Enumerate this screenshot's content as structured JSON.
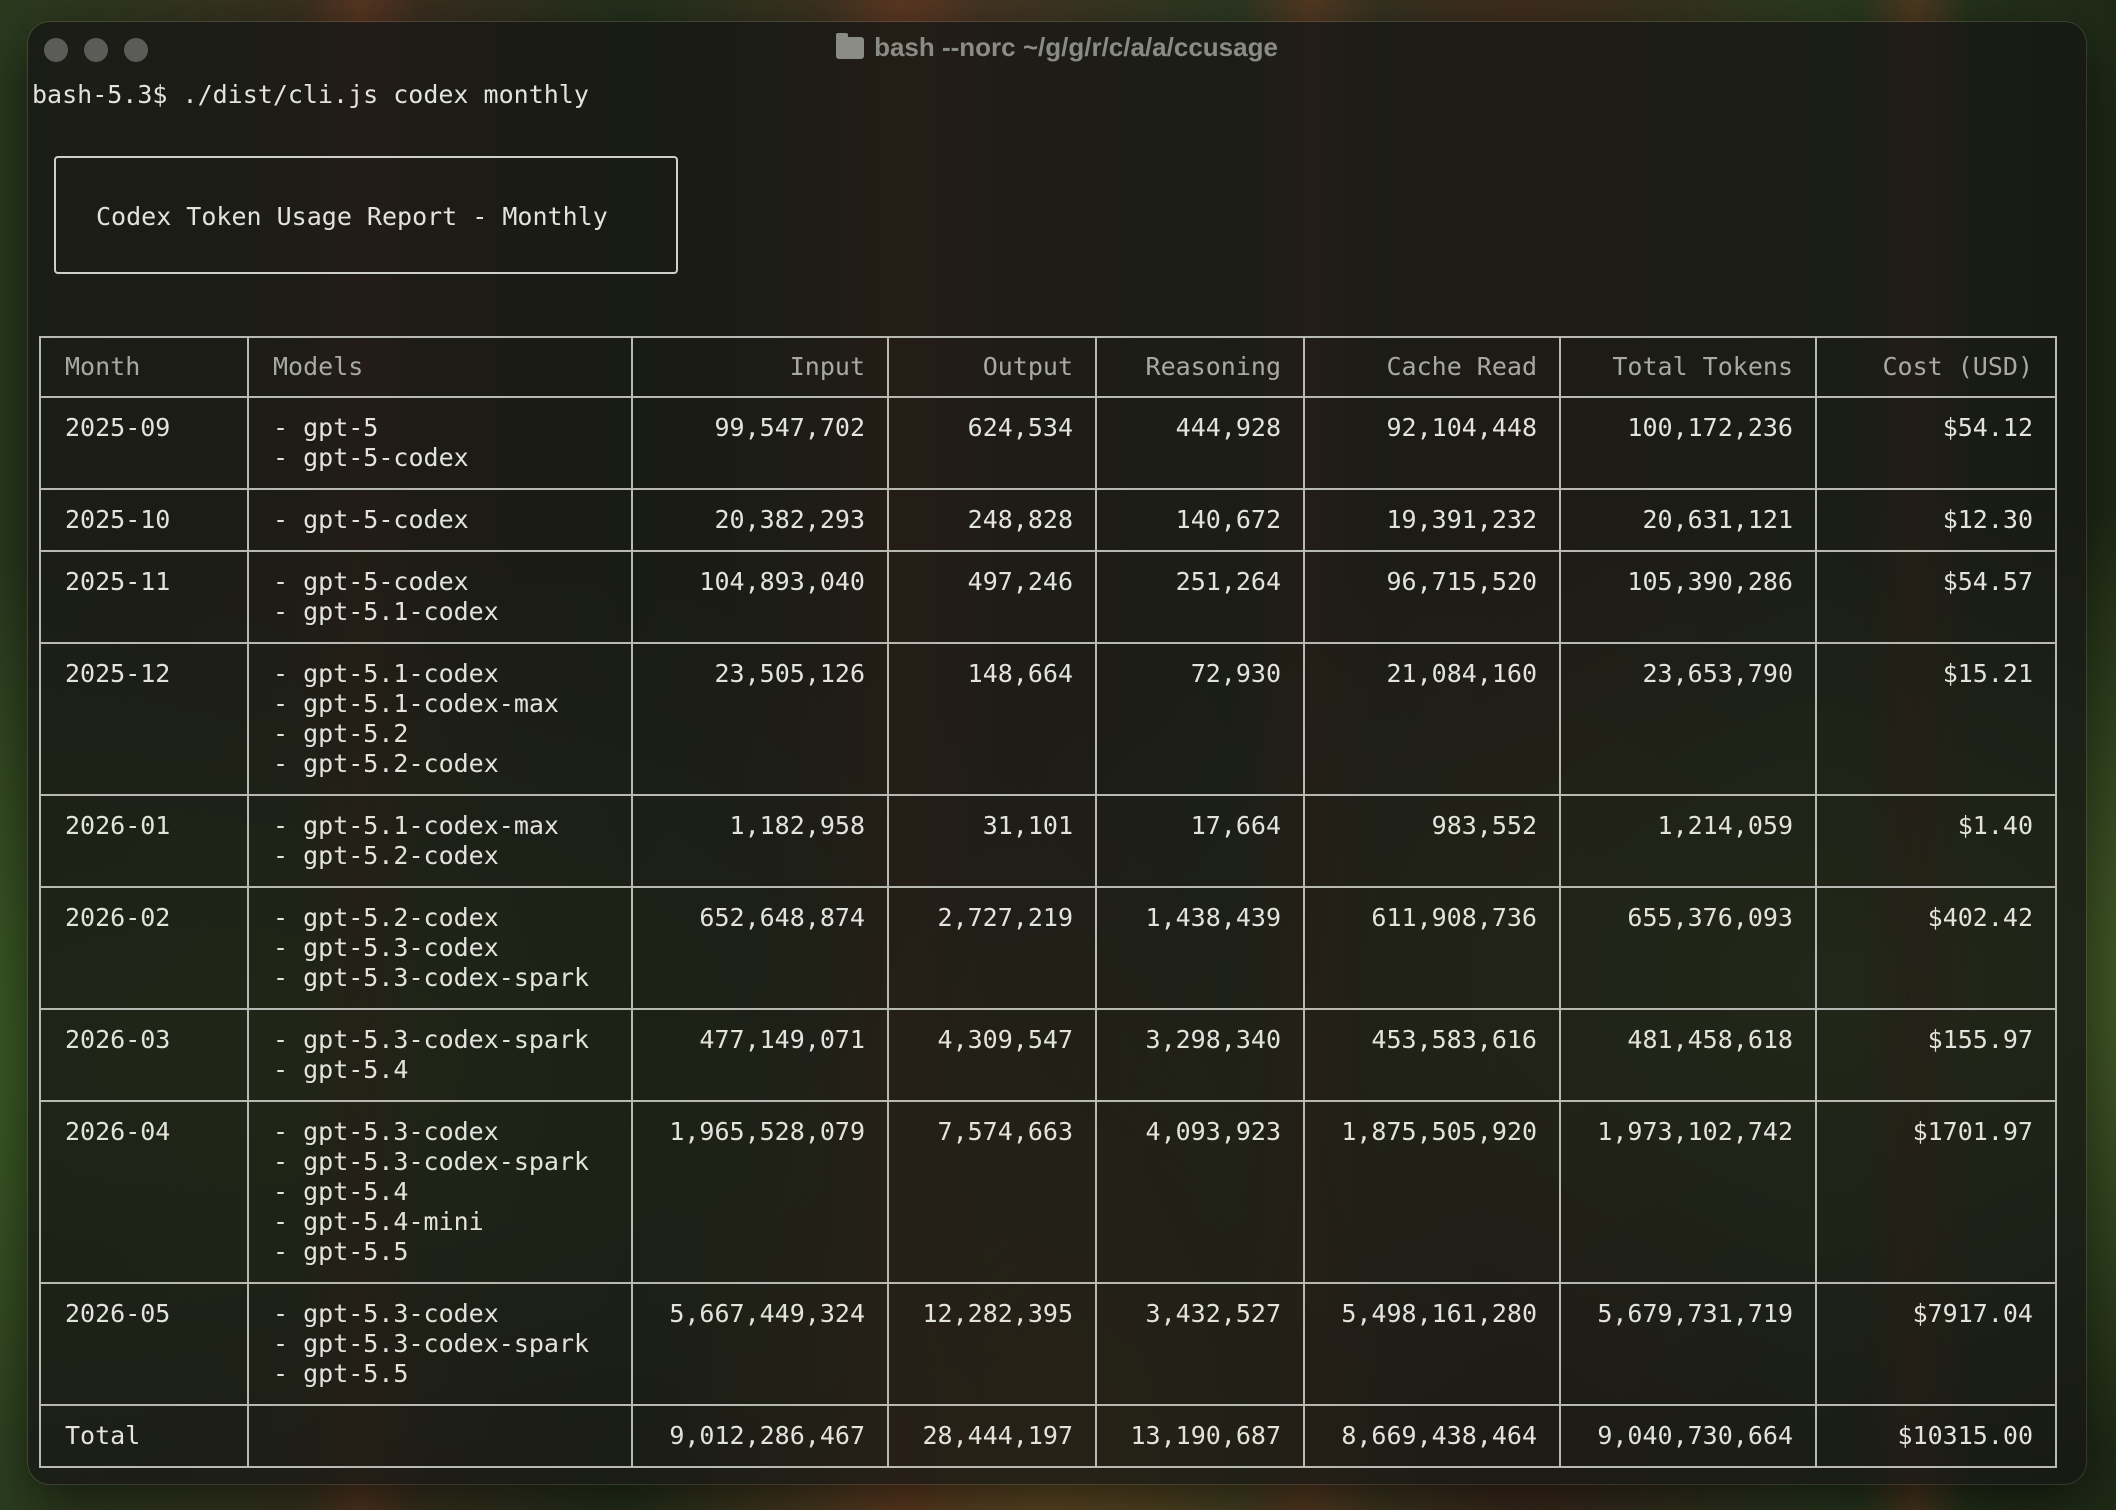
{
  "window": {
    "title": "bash --norc ~/g/g/r/c/a/a/ccusage",
    "title_icon": "folder-icon"
  },
  "terminal": {
    "prompt": "bash-5.3$ ./dist/cli.js codex monthly",
    "report_title": "Codex Token Usage Report - Monthly"
  },
  "table": {
    "headers": [
      "Month",
      "Models",
      "Input",
      "Output",
      "Reasoning",
      "Cache Read",
      "Total Tokens",
      "Cost (USD)"
    ],
    "rows": [
      {
        "month": "2025-09",
        "models": [
          "- gpt-5",
          "- gpt-5-codex"
        ],
        "input": "99,547,702",
        "output": "624,534",
        "reasoning": "444,928",
        "cache_read": "92,104,448",
        "total_tokens": "100,172,236",
        "cost": "$54.12"
      },
      {
        "month": "2025-10",
        "models": [
          "- gpt-5-codex"
        ],
        "input": "20,382,293",
        "output": "248,828",
        "reasoning": "140,672",
        "cache_read": "19,391,232",
        "total_tokens": "20,631,121",
        "cost": "$12.30"
      },
      {
        "month": "2025-11",
        "models": [
          "- gpt-5-codex",
          "- gpt-5.1-codex"
        ],
        "input": "104,893,040",
        "output": "497,246",
        "reasoning": "251,264",
        "cache_read": "96,715,520",
        "total_tokens": "105,390,286",
        "cost": "$54.57"
      },
      {
        "month": "2025-12",
        "models": [
          "- gpt-5.1-codex",
          "- gpt-5.1-codex-max",
          "- gpt-5.2",
          "- gpt-5.2-codex"
        ],
        "input": "23,505,126",
        "output": "148,664",
        "reasoning": "72,930",
        "cache_read": "21,084,160",
        "total_tokens": "23,653,790",
        "cost": "$15.21"
      },
      {
        "month": "2026-01",
        "models": [
          "- gpt-5.1-codex-max",
          "- gpt-5.2-codex"
        ],
        "input": "1,182,958",
        "output": "31,101",
        "reasoning": "17,664",
        "cache_read": "983,552",
        "total_tokens": "1,214,059",
        "cost": "$1.40"
      },
      {
        "month": "2026-02",
        "models": [
          "- gpt-5.2-codex",
          "- gpt-5.3-codex",
          "- gpt-5.3-codex-spark"
        ],
        "input": "652,648,874",
        "output": "2,727,219",
        "reasoning": "1,438,439",
        "cache_read": "611,908,736",
        "total_tokens": "655,376,093",
        "cost": "$402.42"
      },
      {
        "month": "2026-03",
        "models": [
          "- gpt-5.3-codex-spark",
          "- gpt-5.4"
        ],
        "input": "477,149,071",
        "output": "4,309,547",
        "reasoning": "3,298,340",
        "cache_read": "453,583,616",
        "total_tokens": "481,458,618",
        "cost": "$155.97"
      },
      {
        "month": "2026-04",
        "models": [
          "- gpt-5.3-codex",
          "- gpt-5.3-codex-spark",
          "- gpt-5.4",
          "- gpt-5.4-mini",
          "- gpt-5.5"
        ],
        "input": "1,965,528,079",
        "output": "7,574,663",
        "reasoning": "4,093,923",
        "cache_read": "1,875,505,920",
        "total_tokens": "1,973,102,742",
        "cost": "$1701.97"
      },
      {
        "month": "2026-05",
        "models": [
          "- gpt-5.3-codex",
          "- gpt-5.3-codex-spark",
          "- gpt-5.5"
        ],
        "input": "5,667,449,324",
        "output": "12,282,395",
        "reasoning": "3,432,527",
        "cache_read": "5,498,161,280",
        "total_tokens": "5,679,731,719",
        "cost": "$7917.04"
      }
    ],
    "total": {
      "label": "Total",
      "models": "",
      "input": "9,012,286,467",
      "output": "28,444,197",
      "reasoning": "13,190,687",
      "cache_read": "8,669,438,464",
      "total_tokens": "9,040,730,664",
      "cost": "$10315.00"
    }
  }
}
